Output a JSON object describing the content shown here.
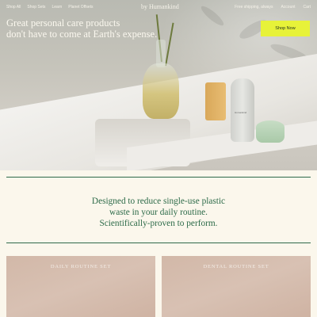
{
  "nav": {
    "left_items": [
      "Shop All",
      "Shop Sets",
      "Learn",
      "Planet Offsets"
    ],
    "logo": "by Humankind",
    "right_items": [
      "Free shipping, always",
      "Account",
      "Cart"
    ]
  },
  "hero": {
    "title_line1": "Great personal care products",
    "title_line2": "don't have to come at Earth's expense.",
    "cta_label": "Shop Now",
    "bottle_label": "Humankind"
  },
  "tagline": {
    "line1": "Designed to reduce single-use plastic",
    "line2": "waste in your daily routine.",
    "line3": "Scientifically-proven to perform."
  },
  "cards": [
    {
      "title": "DAILY ROUTINE SET"
    },
    {
      "title": "DENTAL ROUTINE SET"
    }
  ],
  "colors": {
    "accent_button": "#e7f239",
    "brand_green": "#2c6a48",
    "background": "#fbf7ec"
  }
}
